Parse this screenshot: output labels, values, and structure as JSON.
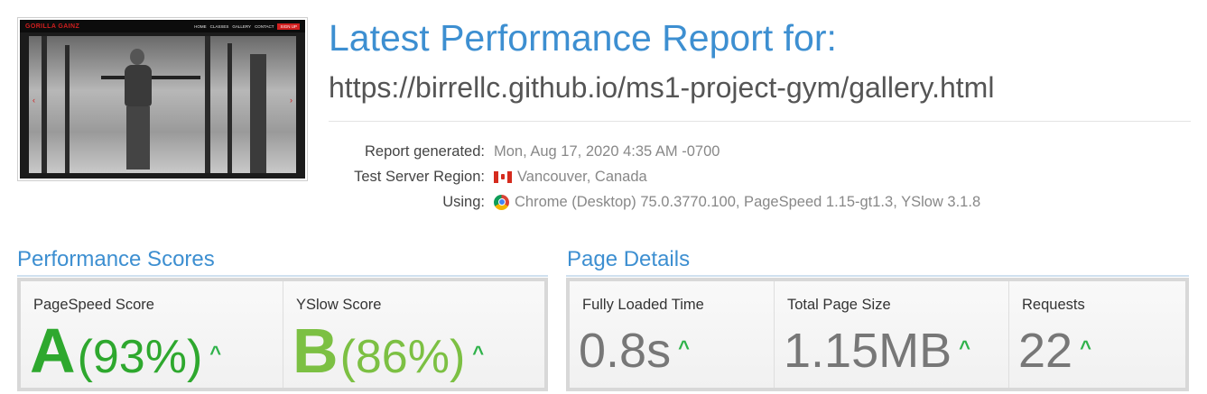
{
  "thumbnail": {
    "logo": "GORILLA GAINZ",
    "nav_links": [
      "HOME",
      "CLASSES",
      "GALLERY",
      "CONTACT"
    ],
    "signup": "SIGN UP"
  },
  "header": {
    "title": "Latest Performance Report for:",
    "url": "https://birrellc.github.io/ms1-project-gym/gallery.html"
  },
  "meta": {
    "generated_label": "Report generated:",
    "generated_value": "Mon, Aug 17, 2020 4:35 AM -0700",
    "region_label": "Test Server Region:",
    "region_value": "Vancouver, Canada",
    "region_flag_icon": "canada-flag-icon",
    "using_label": "Using:",
    "using_value": "Chrome (Desktop) 75.0.3770.100, PageSpeed 1.15-gt1.3, YSlow 3.1.8",
    "using_icon": "chrome-icon"
  },
  "performance_scores": {
    "heading": "Performance Scores",
    "pagespeed": {
      "label": "PageSpeed Score",
      "grade": "A",
      "percent": "(93%)",
      "color": "#2ea82e",
      "trend": "up"
    },
    "yslow": {
      "label": "YSlow Score",
      "grade": "B",
      "percent": "(86%)",
      "color": "#7cc043",
      "trend": "up"
    }
  },
  "page_details": {
    "heading": "Page Details",
    "fully_loaded": {
      "label": "Fully Loaded Time",
      "value": "0.8s",
      "trend": "up"
    },
    "page_size": {
      "label": "Total Page Size",
      "value": "1.15MB",
      "trend": "up"
    },
    "requests": {
      "label": "Requests",
      "value": "22",
      "trend": "up"
    }
  },
  "colors": {
    "accent": "#3d8fd1",
    "trend_up": "#2fb24a"
  }
}
